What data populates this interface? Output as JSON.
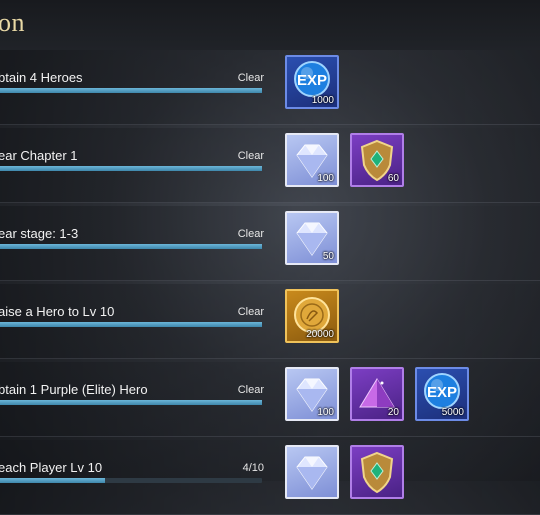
{
  "header": {
    "title": "on"
  },
  "missions": [
    {
      "label": "btain 4 Heroes",
      "status": "Clear",
      "progress": 1.0,
      "rewards": [
        {
          "type": "exp-icon",
          "style": "blue",
          "qty": "1000"
        }
      ]
    },
    {
      "label": "ear Chapter 1",
      "status": "Clear",
      "progress": 1.0,
      "rewards": [
        {
          "type": "diamond-icon",
          "style": "white",
          "qty": "100"
        },
        {
          "type": "shield-emblem-icon",
          "style": "purple",
          "qty": "60"
        }
      ]
    },
    {
      "label": "ear stage: 1-3",
      "status": "Clear",
      "progress": 1.0,
      "rewards": [
        {
          "type": "diamond-icon",
          "style": "white",
          "qty": "50"
        }
      ]
    },
    {
      "label": "aise a Hero to Lv 10",
      "status": "Clear",
      "progress": 1.0,
      "rewards": [
        {
          "type": "gold-coin-icon",
          "style": "gold",
          "qty": "20000"
        }
      ]
    },
    {
      "label": "btain 1 Purple (Elite) Hero",
      "status": "Clear",
      "progress": 1.0,
      "rewards": [
        {
          "type": "diamond-icon",
          "style": "white",
          "qty": "100"
        },
        {
          "type": "purple-crystal-icon",
          "style": "purple",
          "qty": "20"
        },
        {
          "type": "exp-icon",
          "style": "blue",
          "qty": "5000"
        }
      ]
    },
    {
      "label": "each Player Lv 10",
      "status": "4/10",
      "progress": 0.4,
      "rewards": [
        {
          "type": "diamond-icon",
          "style": "white",
          "qty": ""
        },
        {
          "type": "shield-emblem-icon",
          "style": "purple",
          "qty": ""
        }
      ]
    }
  ]
}
